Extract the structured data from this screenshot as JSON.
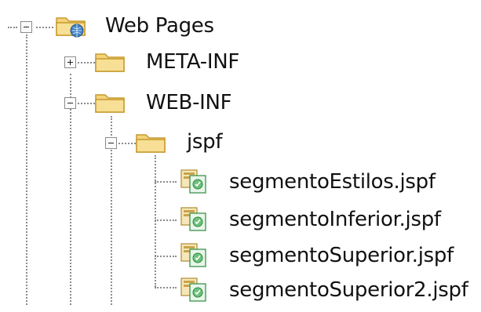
{
  "tree": {
    "root": {
      "label": "Web Pages",
      "icon": "web-folder-icon",
      "expanded": true
    },
    "children": [
      {
        "label": "META-INF",
        "icon": "folder-icon",
        "expanded": false
      },
      {
        "label": "WEB-INF",
        "icon": "folder-icon",
        "expanded": true,
        "children": [
          {
            "label": "jspf",
            "icon": "folder-icon",
            "expanded": true,
            "files": [
              {
                "label": "segmentoEstilos.jspf",
                "icon": "jspf-file-icon"
              },
              {
                "label": "segmentoInferior.jspf",
                "icon": "jspf-file-icon"
              },
              {
                "label": "segmentoSuperior.jspf",
                "icon": "jspf-file-icon"
              },
              {
                "label": "segmentoSuperior2.jspf",
                "icon": "jspf-file-icon"
              }
            ]
          }
        ]
      }
    ]
  },
  "colors": {
    "folder_fill": "#f3d27a",
    "folder_edge": "#c79a2e",
    "line": "#8c8c8c",
    "globe": "#3f7fc0"
  }
}
